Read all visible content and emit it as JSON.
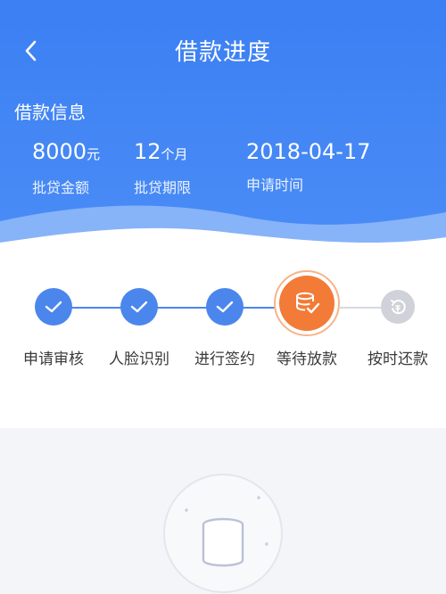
{
  "nav": {
    "title": "借款进度",
    "back_icon": "chevron-left-icon"
  },
  "loan_info": {
    "title": "借款信息",
    "amount": {
      "value": "8000",
      "unit": "元",
      "label": "批贷金额"
    },
    "term": {
      "value": "12",
      "unit": "个月",
      "label": "批贷期限"
    },
    "date": {
      "value": "2018-04-17",
      "label": "申请时间"
    }
  },
  "progress": {
    "steps": [
      {
        "label": "申请审核",
        "status": "done"
      },
      {
        "label": "人脸识别",
        "status": "done"
      },
      {
        "label": "进行签约",
        "status": "done"
      },
      {
        "label": "等待放款",
        "status": "current"
      },
      {
        "label": "按时还款",
        "status": "pending"
      }
    ]
  },
  "colors": {
    "header_blue": "#3b7ff3",
    "step_done": "#4b86ec",
    "step_current": "#f27b37",
    "step_pending": "#cfd2d8"
  }
}
